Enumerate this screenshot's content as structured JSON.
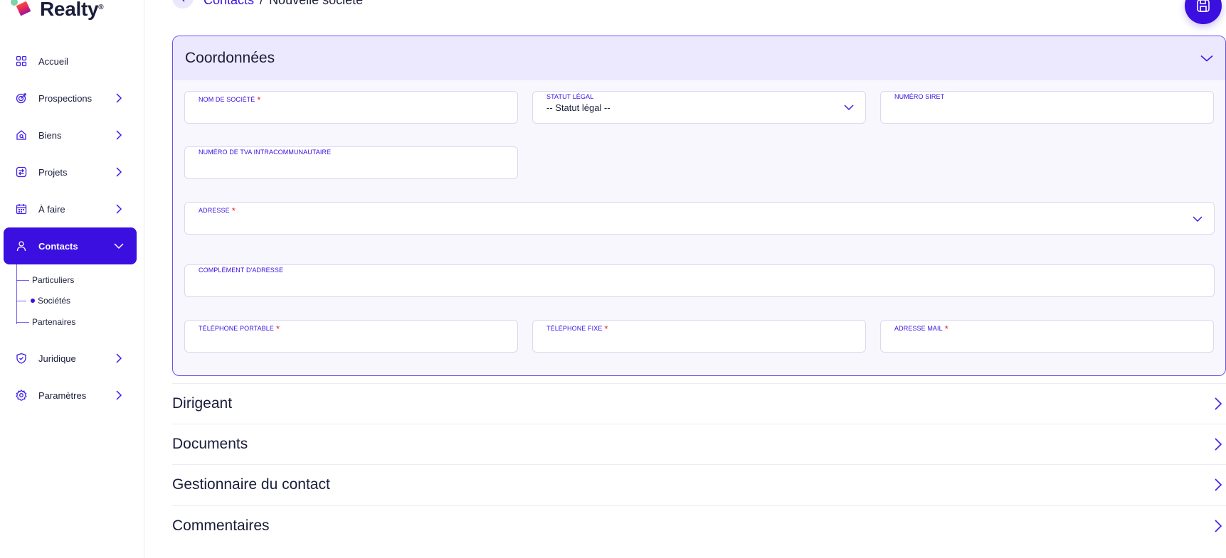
{
  "brand": {
    "name": "Realty",
    "mark": "®"
  },
  "sidebar": {
    "items": [
      {
        "label": "Accueil",
        "icon": "grid-icon",
        "expandable": false
      },
      {
        "label": "Prospections",
        "icon": "target-icon",
        "expandable": true
      },
      {
        "label": "Biens",
        "icon": "house-search-icon",
        "expandable": true
      },
      {
        "label": "Projets",
        "icon": "transfer-icon",
        "expandable": true
      },
      {
        "label": "À faire",
        "icon": "calendar-icon",
        "expandable": true
      },
      {
        "label": "Contacts",
        "icon": "user-icon",
        "expandable": true,
        "active": true
      },
      {
        "label": "Juridique",
        "icon": "shield-icon",
        "expandable": true
      },
      {
        "label": "Paramètres",
        "icon": "gear-icon",
        "expandable": true
      }
    ],
    "contacts_sub": [
      {
        "label": "Particuliers",
        "active": false
      },
      {
        "label": "Sociétés",
        "active": true
      },
      {
        "label": "Partenaires",
        "active": false
      }
    ]
  },
  "breadcrumb": {
    "parent": "Contacts",
    "separator": "/",
    "current": "Nouvelle société"
  },
  "coordonnees": {
    "title": "Coordonnées",
    "fields": {
      "nom": {
        "label": "Nom de société",
        "required": true,
        "value": ""
      },
      "statut": {
        "label": "Statut légal",
        "value": "-- Statut légal --"
      },
      "siret": {
        "label": "Numéro SIRET",
        "value": ""
      },
      "tva": {
        "label": "Numéro de TVA intracommunautaire",
        "value": ""
      },
      "adresse": {
        "label": "Adresse",
        "required": true,
        "value": ""
      },
      "complement": {
        "label": "Complément d'adresse",
        "value": ""
      },
      "tel_portable": {
        "label": "Téléphone portable",
        "required": true,
        "value": ""
      },
      "tel_fixe": {
        "label": "Téléphone fixe",
        "required": true,
        "value": ""
      },
      "mail": {
        "label": "Adresse mail",
        "required": true,
        "value": ""
      }
    }
  },
  "sections": [
    {
      "title": "Dirigeant"
    },
    {
      "title": "Documents"
    },
    {
      "title": "Gestionnaire du contact"
    },
    {
      "title": "Commentaires"
    }
  ],
  "colors": {
    "accent": "#3a0fe0",
    "required": "#e0243a",
    "card_bg": "#f8f7fe",
    "card_head": "#ece8fd"
  }
}
